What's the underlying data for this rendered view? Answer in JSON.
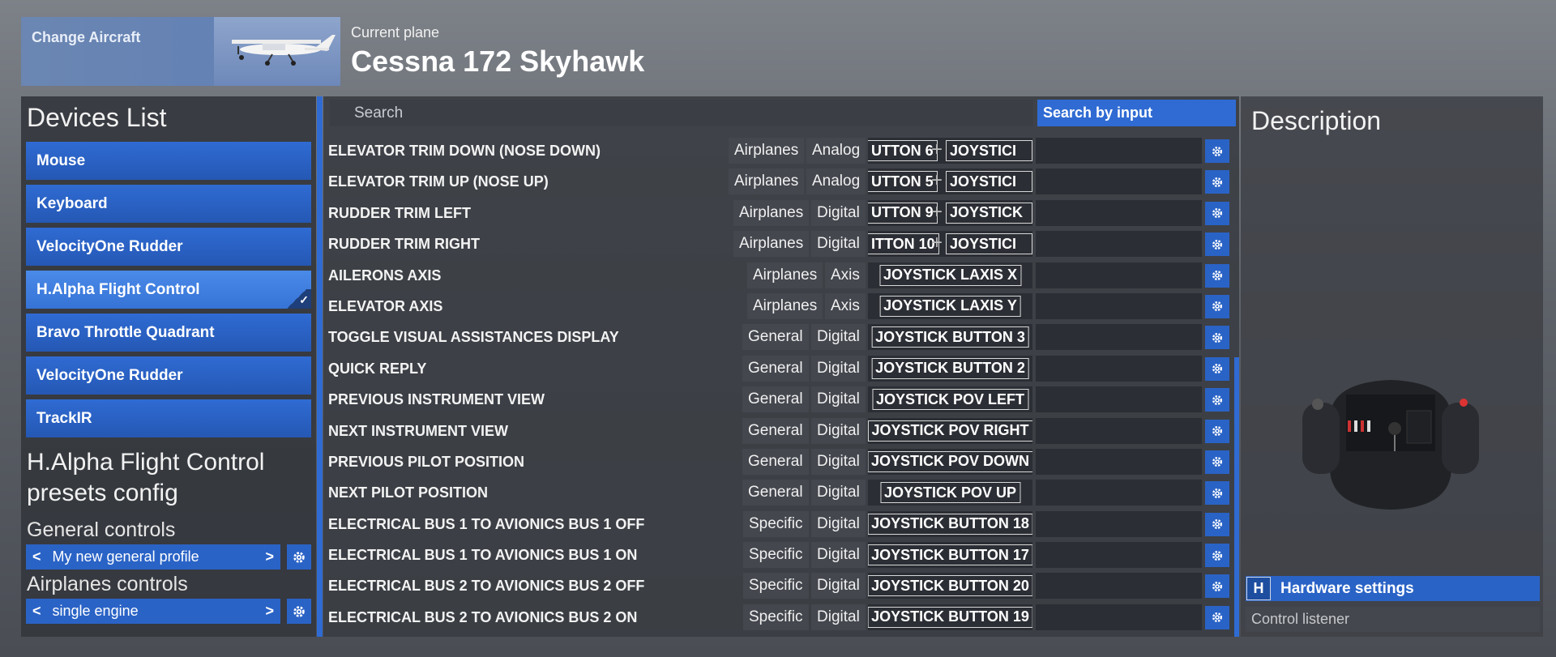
{
  "header": {
    "change_aircraft_label": "Change Aircraft",
    "current_plane_label": "Current plane",
    "current_plane_name": "Cessna 172 Skyhawk"
  },
  "devices": {
    "title": "Devices List",
    "items": [
      {
        "label": "Mouse",
        "selected": false
      },
      {
        "label": "Keyboard",
        "selected": false
      },
      {
        "label": "VelocityOne Rudder",
        "selected": false
      },
      {
        "label": "H.Alpha Flight Control",
        "selected": true
      },
      {
        "label": "Bravo Throttle Quadrant",
        "selected": false
      },
      {
        "label": "VelocityOne Rudder",
        "selected": false
      },
      {
        "label": "TrackIR",
        "selected": false
      }
    ],
    "presets_title": "H.Alpha Flight Control presets config",
    "general_controls_label": "General controls",
    "general_profile": "My new general profile",
    "airplanes_controls_label": "Airplanes controls",
    "airplanes_profile": "single engine"
  },
  "search": {
    "placeholder": "Search",
    "by_input_label": "Search by input"
  },
  "bindings": [
    {
      "name": "ELEVATOR TRIM DOWN (NOSE DOWN)",
      "category": "Airplanes",
      "type": "Analog",
      "key1": "UTTON 6",
      "key2": "JOYSTICI"
    },
    {
      "name": "ELEVATOR TRIM UP (NOSE UP)",
      "category": "Airplanes",
      "type": "Analog",
      "key1": "UTTON 5",
      "key2": "JOYSTICI"
    },
    {
      "name": "RUDDER TRIM LEFT",
      "category": "Airplanes",
      "type": "Digital",
      "key1": "UTTON 9",
      "key2": "JOYSTICK"
    },
    {
      "name": "RUDDER TRIM RIGHT",
      "category": "Airplanes",
      "type": "Digital",
      "key1": "ITTON 10",
      "key2": "JOYSTICI"
    },
    {
      "name": "AILERONS AXIS",
      "category": "Airplanes",
      "type": "Axis",
      "key1": "JOYSTICK LAXIS X",
      "key2": ""
    },
    {
      "name": "ELEVATOR AXIS",
      "category": "Airplanes",
      "type": "Axis",
      "key1": "JOYSTICK LAXIS Y",
      "key2": ""
    },
    {
      "name": "TOGGLE VISUAL ASSISTANCES DISPLAY",
      "category": "General",
      "type": "Digital",
      "key1": "JOYSTICK BUTTON 3",
      "key2": ""
    },
    {
      "name": "QUICK REPLY",
      "category": "General",
      "type": "Digital",
      "key1": "JOYSTICK BUTTON 2",
      "key2": ""
    },
    {
      "name": "PREVIOUS INSTRUMENT VIEW",
      "category": "General",
      "type": "Digital",
      "key1": "JOYSTICK POV LEFT",
      "key2": ""
    },
    {
      "name": "NEXT INSTRUMENT VIEW",
      "category": "General",
      "type": "Digital",
      "key1": "JOYSTICK POV RIGHT",
      "key2": ""
    },
    {
      "name": "PREVIOUS PILOT POSITION",
      "category": "General",
      "type": "Digital",
      "key1": "JOYSTICK POV DOWN",
      "key2": ""
    },
    {
      "name": "NEXT PILOT POSITION",
      "category": "General",
      "type": "Digital",
      "key1": "JOYSTICK POV UP",
      "key2": ""
    },
    {
      "name": "ELECTRICAL BUS 1 TO AVIONICS BUS 1 OFF",
      "category": "Specific",
      "type": "Digital",
      "key1": "JOYSTICK BUTTON 18",
      "key2": ""
    },
    {
      "name": "ELECTRICAL BUS 1 TO AVIONICS BUS 1 ON",
      "category": "Specific",
      "type": "Digital",
      "key1": "JOYSTICK BUTTON 17",
      "key2": ""
    },
    {
      "name": "ELECTRICAL BUS 2 TO AVIONICS BUS 2 OFF",
      "category": "Specific",
      "type": "Digital",
      "key1": "JOYSTICK BUTTON 20",
      "key2": ""
    },
    {
      "name": "ELECTRICAL BUS 2 TO AVIONICS BUS 2 ON",
      "category": "Specific",
      "type": "Digital",
      "key1": "JOYSTICK BUTTON 19",
      "key2": ""
    }
  ],
  "description": {
    "title": "Description",
    "hardware_key": "H",
    "hardware_label": "Hardware settings",
    "control_listener_label": "Control listener"
  },
  "colors": {
    "accent": "#2f6bd3",
    "panel": "#3a3d43"
  }
}
